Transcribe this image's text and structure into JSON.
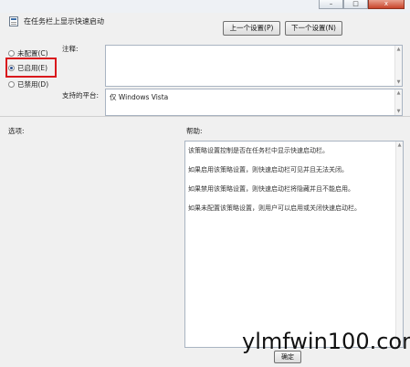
{
  "window": {
    "title": "在任务栏上显示快速启动",
    "controls": {
      "minimize": "–",
      "maximize": "□",
      "close": "x"
    }
  },
  "nav": {
    "prev_setting": "上一个设置(P)",
    "next_setting": "下一个设置(N)"
  },
  "state_options": [
    {
      "label": "未配置(C)",
      "checked": false
    },
    {
      "label": "已启用(E)",
      "checked": true
    },
    {
      "label": "已禁用(D)",
      "checked": false
    }
  ],
  "comment": {
    "label": "注释:",
    "value": ""
  },
  "supported_on": {
    "label": "支持的平台:",
    "value": "仅 Windows Vista"
  },
  "options": {
    "label": "选项:"
  },
  "help": {
    "label": "帮助:",
    "paragraphs": [
      "该策略设置控制是否在任务栏中显示快速启动栏。",
      "如果启用该策略设置，则快速启动栏可见并且无法关闭。",
      "如果禁用该策略设置，则快速启动栏将隐藏并且不能启用。",
      "如果未配置该策略设置，则用户可以启用或关闭快速启动栏。"
    ]
  },
  "footer": {
    "ok_label": "确定"
  },
  "watermark": "ylmfwin100.com",
  "colors": {
    "highlight": "#d9181c",
    "radio_dot": "#2a4f8f"
  }
}
